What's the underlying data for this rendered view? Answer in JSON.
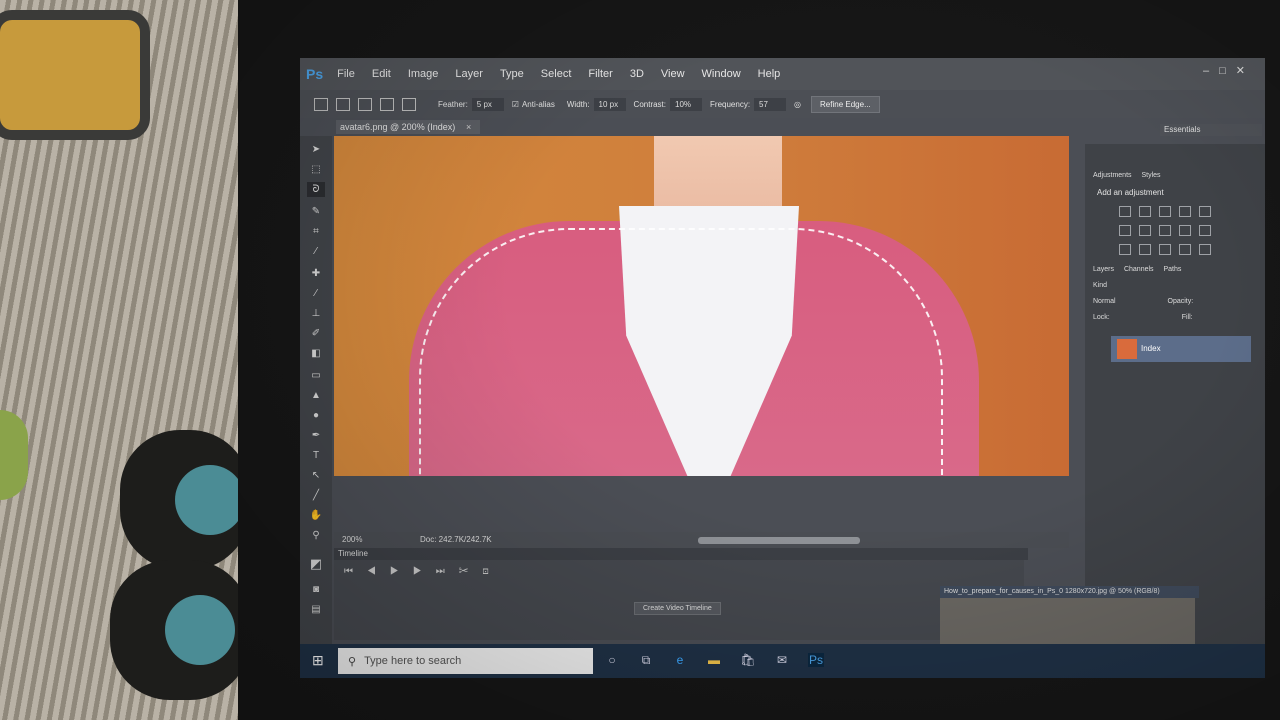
{
  "app": {
    "logo": "Ps"
  },
  "menu": [
    "File",
    "Edit",
    "Image",
    "Layer",
    "Type",
    "Select",
    "Filter",
    "3D",
    "View",
    "Window",
    "Help"
  ],
  "options": {
    "feather_label": "Feather:",
    "feather_value": "5 px",
    "antialias_label": "Anti-alias",
    "width_label": "Width:",
    "width_value": "10 px",
    "contrast_label": "Contrast:",
    "contrast_value": "10%",
    "frequency_label": "Frequency:",
    "frequency_value": "57",
    "refine_label": "Refine Edge..."
  },
  "document": {
    "tab_title": "avatar6.png @ 200% (Index)",
    "close": "×"
  },
  "status": {
    "zoom": "200%",
    "doc": "Doc: 242.7K/242.7K"
  },
  "timeline": {
    "header": "Timeline",
    "create_button": "Create Video Timeline"
  },
  "panels": {
    "workspace": "Essentials",
    "adjust_tabs": [
      "Adjustments",
      "Styles"
    ],
    "adjust_title": "Add an adjustment",
    "layer_tabs": [
      "Layers",
      "Channels",
      "Paths"
    ],
    "kind": "Kind",
    "blend_mode": "Normal",
    "opacity_label": "Opacity:",
    "lock_label": "Lock:",
    "fill_label": "Fill:",
    "layer_name": "Index"
  },
  "popup": {
    "title": "How_to_prepare_for_causes_in_Ps_0 1280x720.jpg @ 50% (RGB/8)"
  },
  "taskbar": {
    "search_placeholder": "Type here to search"
  }
}
